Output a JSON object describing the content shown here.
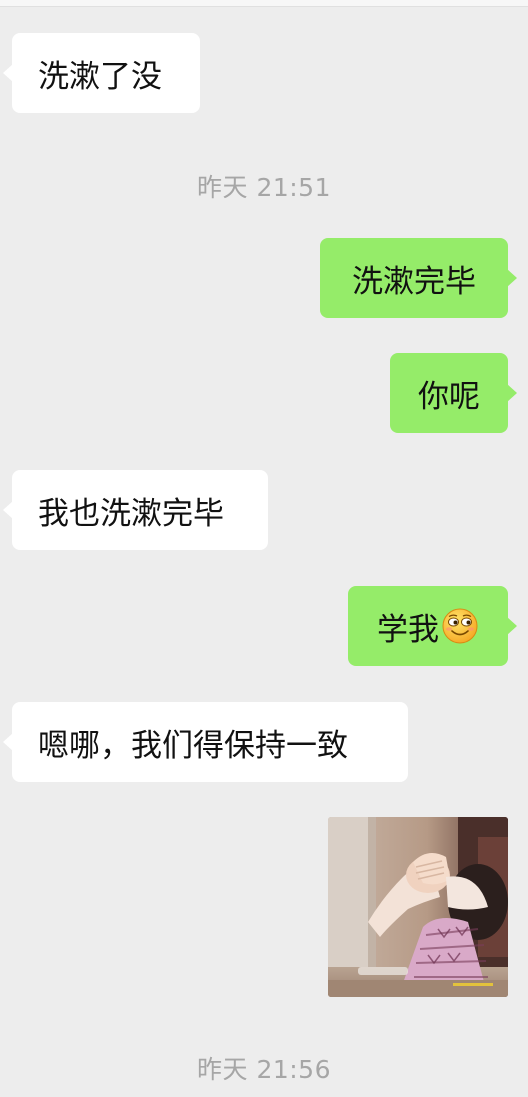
{
  "chat": {
    "timestamps": [
      "昨天 21:51",
      "昨天 21:56"
    ],
    "messages": [
      {
        "side": "in",
        "text": "洗漱了没"
      },
      {
        "side": "out",
        "text": "洗漱完毕"
      },
      {
        "side": "out",
        "text": "你呢"
      },
      {
        "side": "in",
        "text": "我也洗漱完毕"
      },
      {
        "side": "out",
        "text": "学我",
        "emoji": "smirk-emoji-icon"
      },
      {
        "side": "in",
        "text": "嗯哪，我们得保持一致"
      },
      {
        "side": "out",
        "type": "image",
        "image": "child-covering-face-photo"
      }
    ]
  },
  "colors": {
    "background": "#ededed",
    "incoming_bubble": "#ffffff",
    "outgoing_bubble": "#95ec69",
    "timestamp_text": "#a6a6a6"
  }
}
